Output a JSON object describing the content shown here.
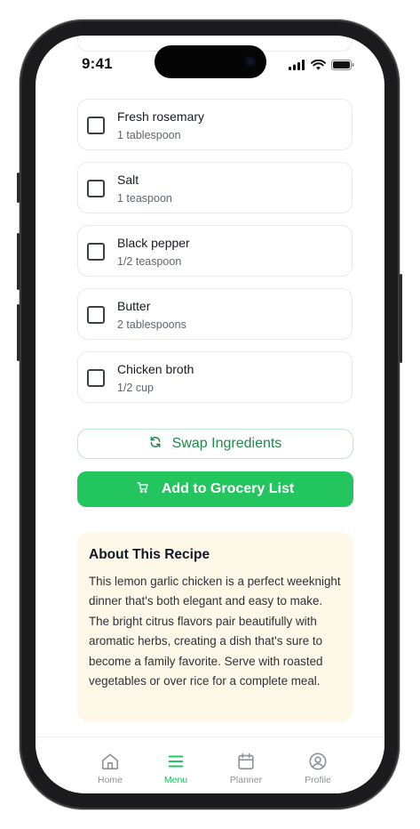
{
  "status_bar": {
    "time": "9:41"
  },
  "ingredients": [
    {
      "name": "Fresh rosemary",
      "quantity": "1 tablespoon"
    },
    {
      "name": "Salt",
      "quantity": "1 teaspoon"
    },
    {
      "name": "Black pepper",
      "quantity": "1/2 teaspoon"
    },
    {
      "name": "Butter",
      "quantity": "2 tablespoons"
    },
    {
      "name": "Chicken broth",
      "quantity": "1/2 cup"
    }
  ],
  "actions": {
    "swap_label": "Swap Ingredients",
    "add_label": "Add to Grocery List"
  },
  "about": {
    "title": "About This Recipe",
    "text": "This lemon garlic chicken is a perfect weeknight dinner that's both elegant and easy to make. The bright citrus flavors pair beautifully with aromatic herbs, creating a dish that's sure to become a family favorite. Serve with roasted vegetables or over rice for a complete meal."
  },
  "tabs": [
    {
      "label": "Home",
      "icon": "home-icon",
      "active": false
    },
    {
      "label": "Menu",
      "icon": "menu-icon",
      "active": true
    },
    {
      "label": "Planner",
      "icon": "calendar-icon",
      "active": false
    },
    {
      "label": "Profile",
      "icon": "profile-icon",
      "active": false
    }
  ],
  "colors": {
    "accent": "#22c55e",
    "accent_text": "#1e8a45",
    "about_bg": "#fdf8e8"
  }
}
